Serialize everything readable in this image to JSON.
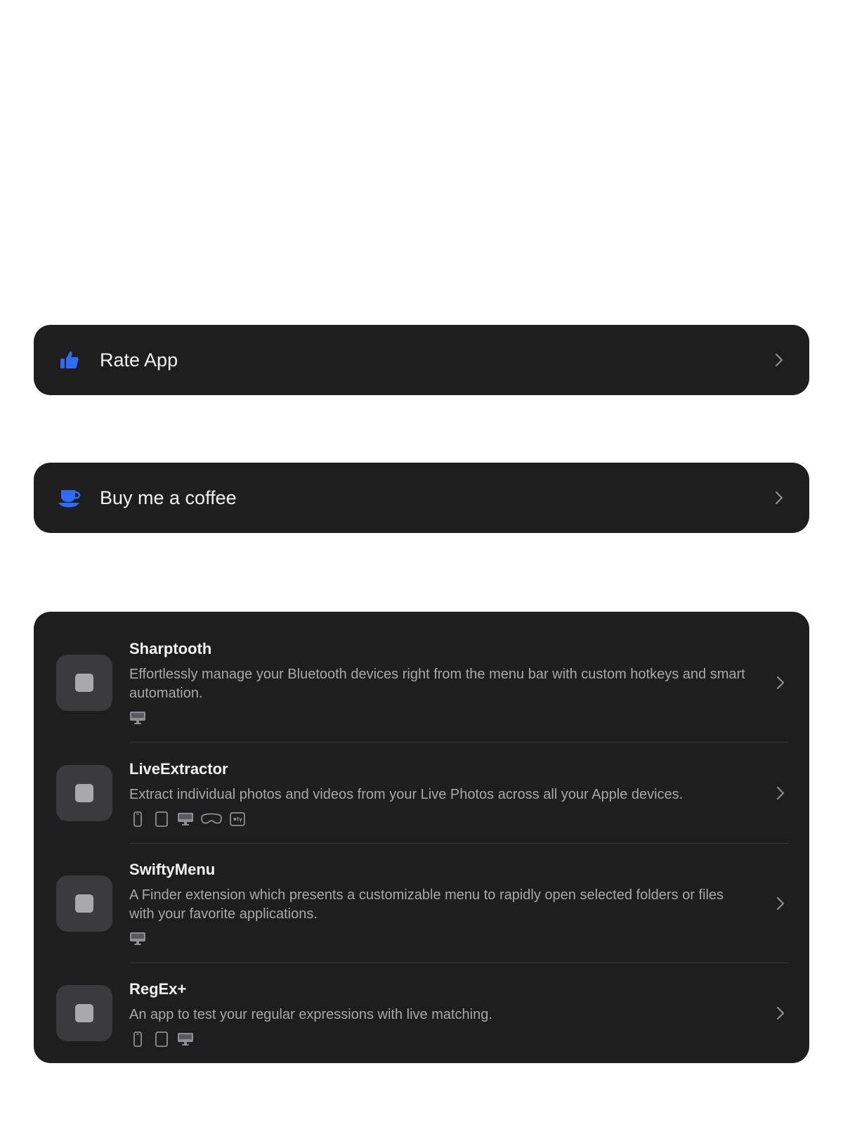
{
  "actions": {
    "rate": {
      "label": "Rate App",
      "icon": "thumbs-up-icon"
    },
    "coffee": {
      "label": "Buy me a coffee",
      "icon": "coffee-cup-icon"
    }
  },
  "apps": [
    {
      "name": "Sharptooth",
      "description": "Effortlessly manage your Bluetooth devices right from the menu bar with custom hotkeys and smart automation.",
      "platforms": [
        "mac"
      ]
    },
    {
      "name": "LiveExtractor",
      "description": "Extract individual photos and videos from your Live Photos across all your Apple devices.",
      "platforms": [
        "iphone",
        "ipad",
        "mac",
        "vision",
        "tv"
      ]
    },
    {
      "name": "SwiftyMenu",
      "description": "A Finder extension which presents a customizable menu to rapidly open selected folders or files with your favorite applications.",
      "platforms": [
        "mac"
      ]
    },
    {
      "name": "RegEx+",
      "description": "An app to test your regular expressions with live matching.",
      "platforms": [
        "iphone",
        "ipad",
        "mac"
      ]
    }
  ],
  "colors": {
    "accent": "#2f6cf6",
    "card_bg": "#1e1e1f",
    "text_primary": "#f2f2f2",
    "text_secondary": "#a8a8aa"
  }
}
